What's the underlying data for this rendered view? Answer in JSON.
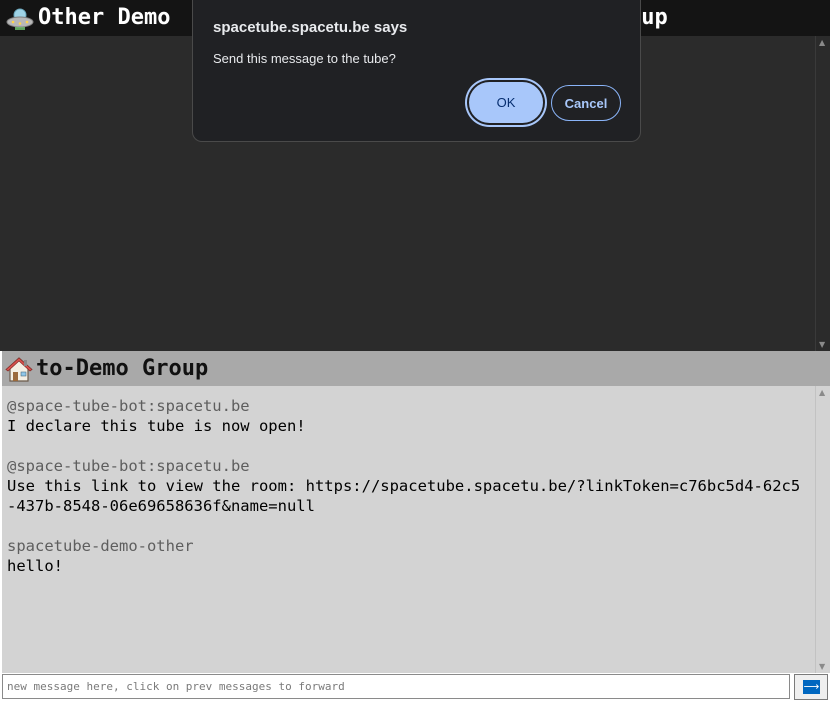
{
  "top_pane": {
    "title_left": "Other Demo",
    "title_right": "oup",
    "icon": "ufo-icon"
  },
  "bottom_pane": {
    "title": "to-Demo Group",
    "icon": "house-icon",
    "messages": [
      {
        "sender": "@space-tube-bot:spacetu.be",
        "body": "I declare this tube is now open!"
      },
      {
        "sender": "@space-tube-bot:spacetu.be",
        "body": "Use this link to view the room: https://spacetube.spacetu.be/?linkToken=c76bc5d4-62c5-437b-8548-06e69658636f&name=null"
      },
      {
        "sender": "spacetube-demo-other",
        "body": "hello!"
      }
    ]
  },
  "composer": {
    "placeholder": "new message here, click on prev messages to forward",
    "send_icon": "arrow-right-icon"
  },
  "dialog": {
    "title": "spacetube.spacetu.be says",
    "message": "Send this message to the tube?",
    "ok_label": "OK",
    "cancel_label": "Cancel"
  },
  "colors": {
    "top_background": "#2b2b2b",
    "top_header": "#141414",
    "bottom_background": "#d3d3d3",
    "bottom_header": "#a9a9a9",
    "dialog_background": "#202124",
    "ok_button": "#a8c7fa"
  }
}
